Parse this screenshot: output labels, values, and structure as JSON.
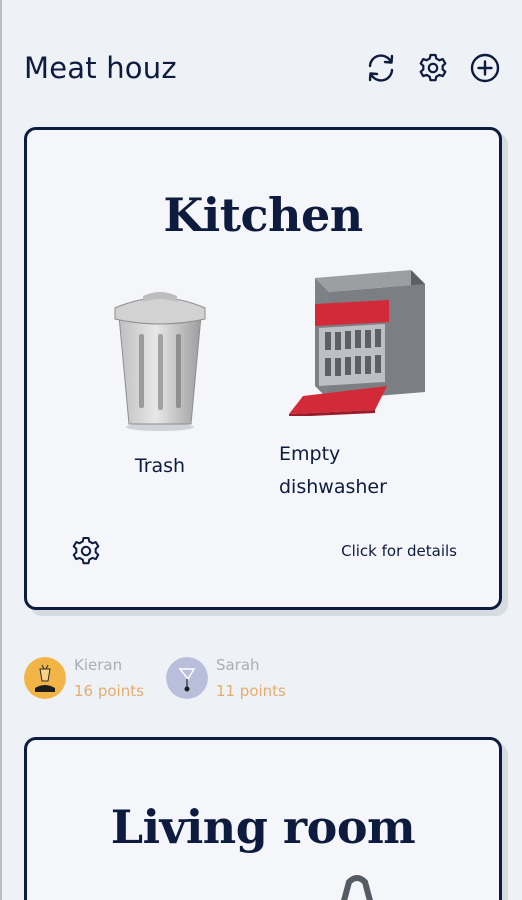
{
  "header": {
    "title": "Meat houz",
    "icons": [
      "refresh-icon",
      "gear-icon",
      "plus-circle-icon"
    ]
  },
  "rooms": [
    {
      "name": "Kitchen",
      "chores": [
        {
          "label": "Trash",
          "icon": "trash-can-icon"
        },
        {
          "label": "Empty dishwasher",
          "icon": "dishwasher-icon"
        }
      ],
      "details_label": "Click for details"
    },
    {
      "name": "Living room"
    }
  ],
  "scoreboard": [
    {
      "name": "Kieran",
      "points": "16 points",
      "avatar_color": "#f2b444"
    },
    {
      "name": "Sarah",
      "points": "11 points",
      "avatar_color": "#b9bedb"
    }
  ],
  "colors": {
    "navy": "#0d1b3e",
    "background": "#eef1f5",
    "points": "#e4ad6f",
    "muted": "#a9aeb8"
  }
}
